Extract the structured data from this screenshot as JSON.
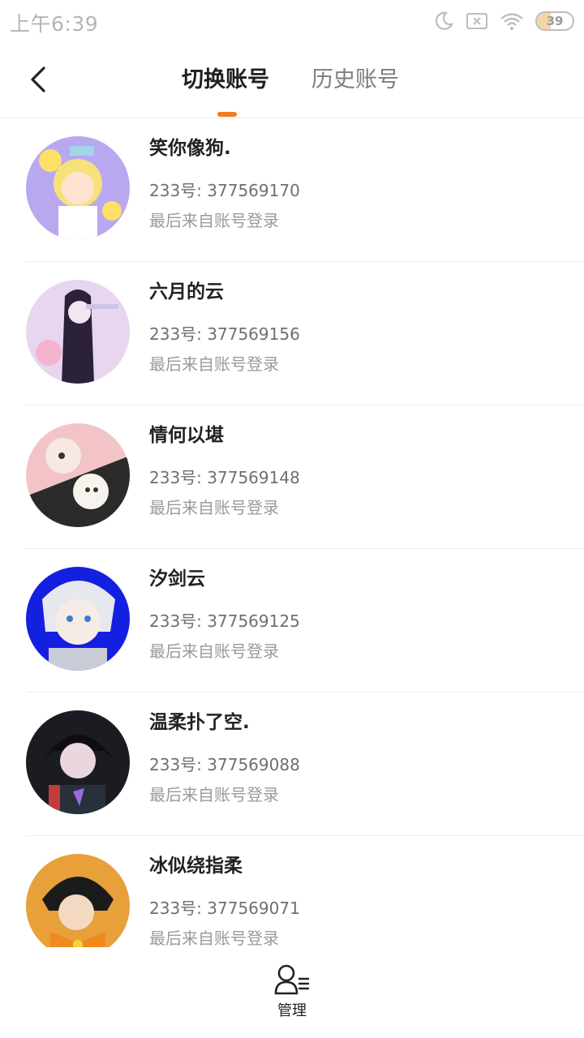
{
  "status_bar": {
    "time": "上午6:39",
    "icons": [
      "moon-icon",
      "sim-missing-icon",
      "wifi-icon",
      "battery-icon"
    ],
    "battery_level": "39",
    "battery_fraction": 0.39
  },
  "header": {
    "back_icon": "chevron-left-icon",
    "tabs": [
      {
        "label": "切换账号",
        "active": true
      },
      {
        "label": "历史账号",
        "active": false
      }
    ],
    "accent_color": "#f07c22"
  },
  "accounts": [
    {
      "name": "笑你像狗.",
      "uid": "233号: 377569170",
      "source": "最后来自账号登录"
    },
    {
      "name": "六月的云",
      "uid": "233号: 377569156",
      "source": "最后来自账号登录"
    },
    {
      "name": "情何以堪",
      "uid": "233号: 377569148",
      "source": "最后来自账号登录"
    },
    {
      "name": "汐剑云",
      "uid": "233号: 377569125",
      "source": "最后来自账号登录"
    },
    {
      "name": "温柔扑了空.",
      "uid": "233号: 377569088",
      "source": "最后来自账号登录"
    },
    {
      "name": "冰似绕指柔",
      "uid": "233号: 377569071",
      "source": "最后来自账号登录"
    }
  ],
  "bottom_bar": {
    "manage_icon": "user-manage-icon",
    "manage_label": "管理"
  }
}
